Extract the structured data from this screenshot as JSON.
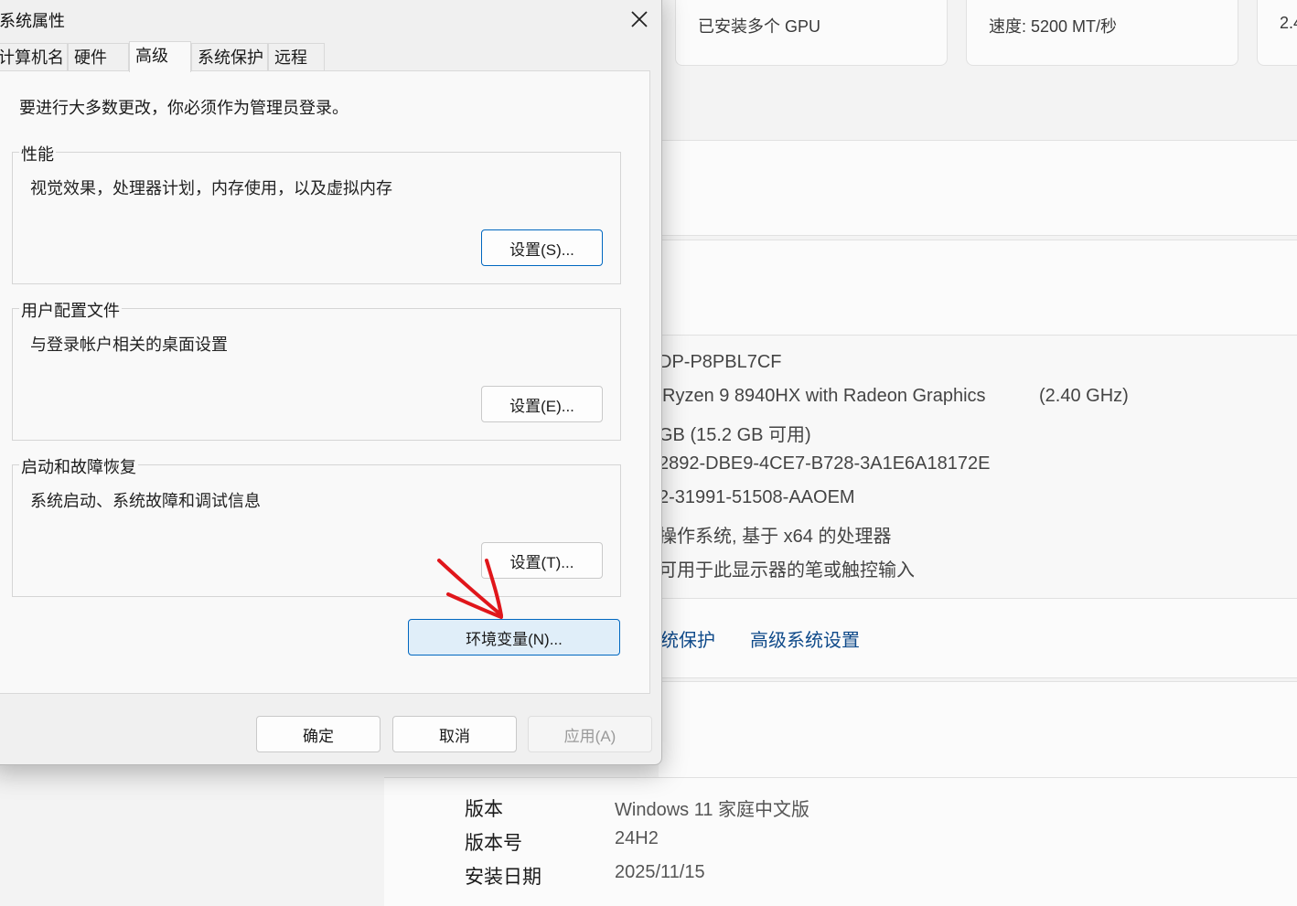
{
  "background": {
    "top_cards": [
      "已安装多个 GPU",
      "速度: 5200 MT/秒",
      "2.4"
    ],
    "specs": [
      "DP-P8PBL7CF",
      "Ryzen 9 8940HX with Radeon Graphics",
      "(2.40 GHz)",
      "GB (15.2 GB 可用)",
      "2892-DBE9-4CE7-B728-3A1E6A18172E",
      "2-31991-51508-AAOEM",
      "操作系统, 基于 x64 的处理器",
      "可用于此显示器的笔或触控输入"
    ],
    "links": {
      "system_protection": "统保护",
      "advanced_settings": "高级系统设置"
    },
    "windows_spec": {
      "edition_label": "版本",
      "edition_value": "Windows 11 家庭中文版",
      "version_label": "版本号",
      "version_value": "24H2",
      "install_label": "安装日期",
      "install_value": "2025/11/15"
    }
  },
  "dialog": {
    "title": "系统属性",
    "tabs": [
      "计算机名",
      "硬件",
      "高级",
      "系统保护",
      "远程"
    ],
    "active_tab": "高级",
    "admin_note": "要进行大多数更改，你必须作为管理员登录。",
    "performance": {
      "title": "性能",
      "desc": "视觉效果，处理器计划，内存使用，以及虚拟内存",
      "button": "设置(S)..."
    },
    "user_profiles": {
      "title": "用户配置文件",
      "desc": "与登录帐户相关的桌面设置",
      "button": "设置(E)..."
    },
    "startup_recovery": {
      "title": "启动和故障恢复",
      "desc": "系统启动、系统故障和调试信息",
      "button": "设置(T)..."
    },
    "env_button": "环境变量(N)...",
    "ok": "确定",
    "cancel": "取消",
    "apply": "应用(A)"
  },
  "colors": {
    "accent": "#0067c0",
    "link": "#0f4a8a",
    "annotation": "#e0161b",
    "hover_bg": "#e0eef9"
  }
}
